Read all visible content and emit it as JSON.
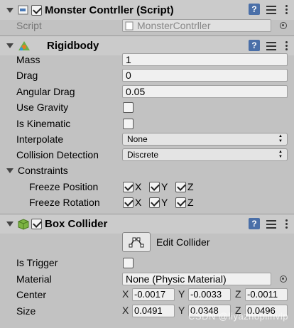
{
  "script_component": {
    "title": "Monster Contrller (Script)",
    "script_label": "Script",
    "script_value": "MonsterContrller"
  },
  "rigidbody": {
    "title": "Rigidbody",
    "mass_label": "Mass",
    "mass": "1",
    "drag_label": "Drag",
    "drag": "0",
    "angular_drag_label": "Angular Drag",
    "angular_drag": "0.05",
    "use_gravity_label": "Use Gravity",
    "is_kinematic_label": "Is Kinematic",
    "interpolate_label": "Interpolate",
    "interpolate": "None",
    "collision_detection_label": "Collision Detection",
    "collision_detection": "Discrete",
    "constraints_label": "Constraints",
    "freeze_position_label": "Freeze Position",
    "freeze_rotation_label": "Freeze Rotation",
    "axis_x": "X",
    "axis_y": "Y",
    "axis_z": "Z"
  },
  "box_collider": {
    "title": "Box Collider",
    "edit_collider_label": "Edit Collider",
    "is_trigger_label": "Is Trigger",
    "material_label": "Material",
    "material": "None (Physic Material)",
    "center_label": "Center",
    "center_x": "-0.0017",
    "center_y": "-0.0033",
    "center_z": "-0.0011",
    "size_label": "Size",
    "size_x": "0.0491",
    "size_y": "0.0348",
    "size_z": "0.0496",
    "axis_x": "X",
    "axis_y": "Y",
    "axis_z": "Z"
  },
  "watermark": "CSDN @liyazhoplinvip",
  "colors": {
    "background": "#c2c2c2",
    "header": "#cbcbcb",
    "help": "#4a6fa8"
  }
}
